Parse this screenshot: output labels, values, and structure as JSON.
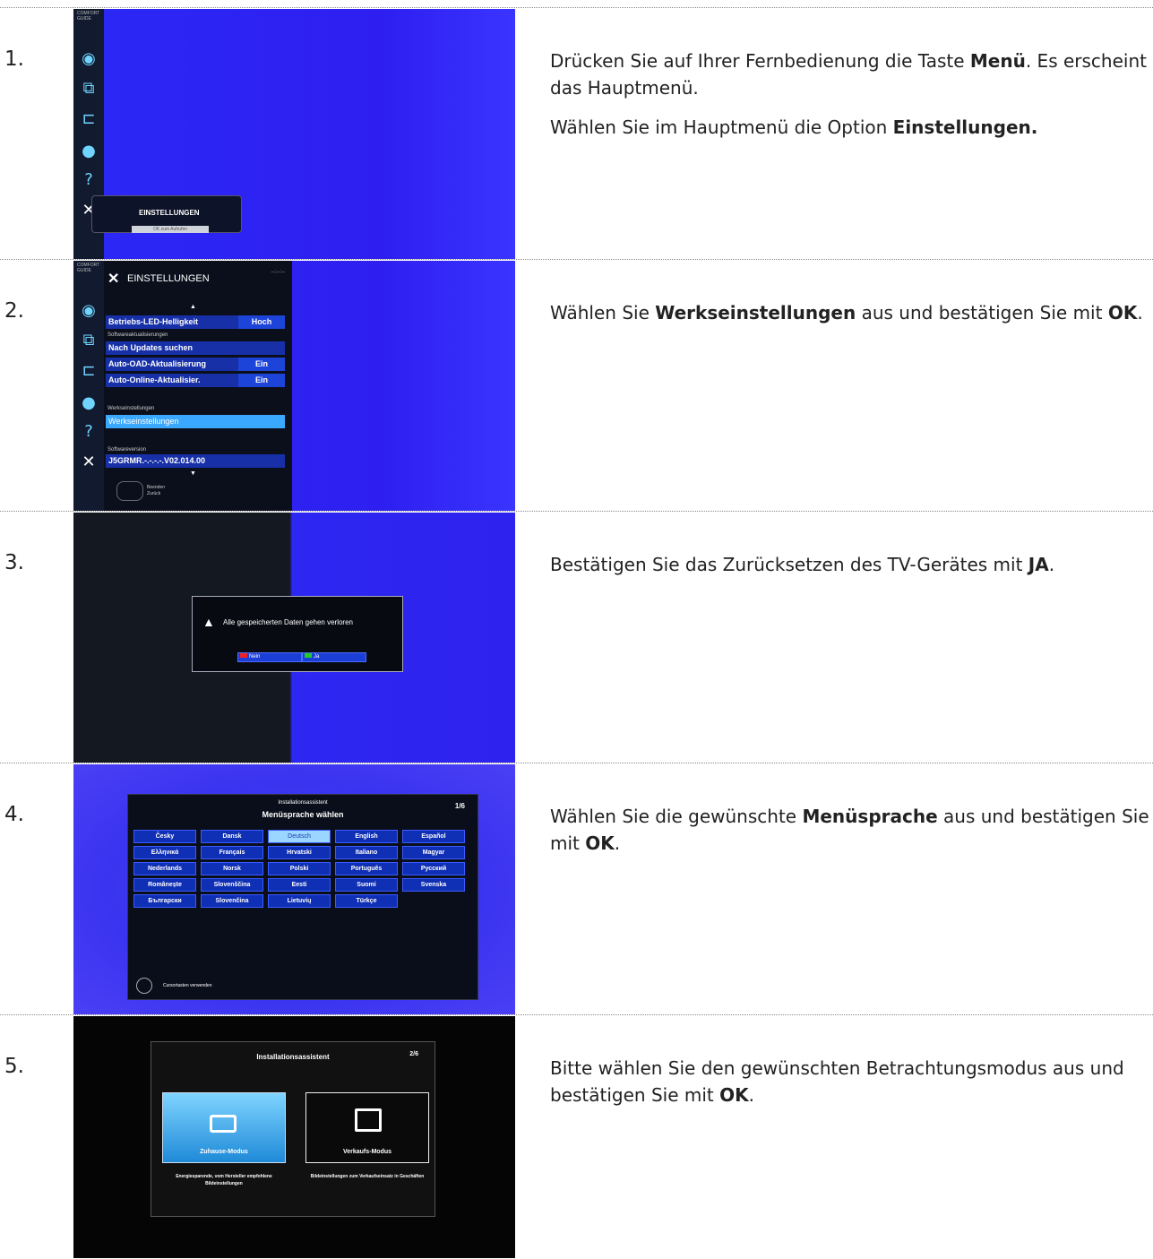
{
  "steps": [
    {
      "number": "1.",
      "paragraphs": [
        [
          "Drücken Sie auf Ihrer Fernbedienung die Taste ",
          {
            "b": "Menü"
          },
          ". Es erscheint das Hauptmenü."
        ],
        [
          "Wählen Sie im Hauptmenü die Option ",
          {
            "b": "Einstellungen."
          }
        ]
      ],
      "screen": {
        "brand": "COMFORT GUIDE",
        "popup_label": "EINSTELLUNGEN",
        "popup_hint": "OK zum Aufrufen"
      }
    },
    {
      "number": "2.",
      "paragraphs": [
        [
          "Wählen Sie ",
          {
            "b": "Werkseinstellungen"
          },
          " aus und bestätigen Sie mit ",
          {
            "b": "OK"
          },
          "."
        ]
      ],
      "screen": {
        "title": "EINSTELLUNGEN",
        "clock": "--:--:--",
        "rows": [
          {
            "label": "Betriebs-LED-Helligkeit",
            "value": "Hoch"
          },
          {
            "label": "Nach Updates suchen",
            "value": ""
          },
          {
            "label": "Auto-OAD-Aktualisierung",
            "value": "Ein"
          },
          {
            "label": "Auto-Online-Aktualisier.",
            "value": "Ein"
          },
          {
            "label": "Werkseinstellungen",
            "value": ""
          },
          {
            "label": "J5GRMR.-.-.-.-.V02.014.00",
            "value": ""
          }
        ],
        "captions": [
          "Softwareaktualisierungen",
          "Werkseinstellungen",
          "Softwareversion"
        ],
        "footer": [
          "Beenden",
          "Zurück"
        ]
      }
    },
    {
      "number": "3.",
      "paragraphs": [
        [
          "Bestätigen Sie das Zurücksetzen des TV-Gerätes mit ",
          {
            "b": "JA"
          },
          "."
        ]
      ],
      "screen": {
        "message": "Alle gespeicherten Daten gehen verloren",
        "btn_no": "Nein",
        "btn_yes": "Ja"
      }
    },
    {
      "number": "4.",
      "paragraphs": [
        [
          "Wählen Sie die gewünschte ",
          {
            "b": "Menüsprache"
          },
          " aus und bestätigen Sie mit ",
          {
            "b": "OK"
          },
          "."
        ]
      ],
      "screen": {
        "subtitle": "Installationsassistent",
        "title": "Menüsprache wählen",
        "page": "1/6",
        "languages": [
          "Česky",
          "Dansk",
          "Deutsch",
          "English",
          "Español",
          "Ελληνικά",
          "Français",
          "Hrvatski",
          "Italiano",
          "Magyar",
          "Nederlands",
          "Norsk",
          "Polski",
          "Português",
          "Русский",
          "Românește",
          "Slovenščina",
          "Eesti",
          "Suomi",
          "Svenska",
          "Български",
          "Slovenčina",
          "Lietuvių",
          "Türkçe"
        ],
        "selected": "Deutsch",
        "hint": "Cursortasten verwenden"
      }
    },
    {
      "number": "5.",
      "paragraphs": [
        [
          "Bitte wählen Sie den gewünschten Betrachtungsmodus aus und bestätigen Sie mit ",
          {
            "b": "OK"
          },
          "."
        ]
      ],
      "screen": {
        "title": "Installationsassistent",
        "page": "2/6",
        "mode_home": "Zuhause-Modus",
        "mode_shop": "Verkaufs-Modus",
        "desc_home": "Energiesparende, vom Hersteller empfohlene Bildeinstellungen",
        "desc_shop": "Bildeinstellungen zum Verkaufseinsatz in Geschäften"
      }
    }
  ]
}
